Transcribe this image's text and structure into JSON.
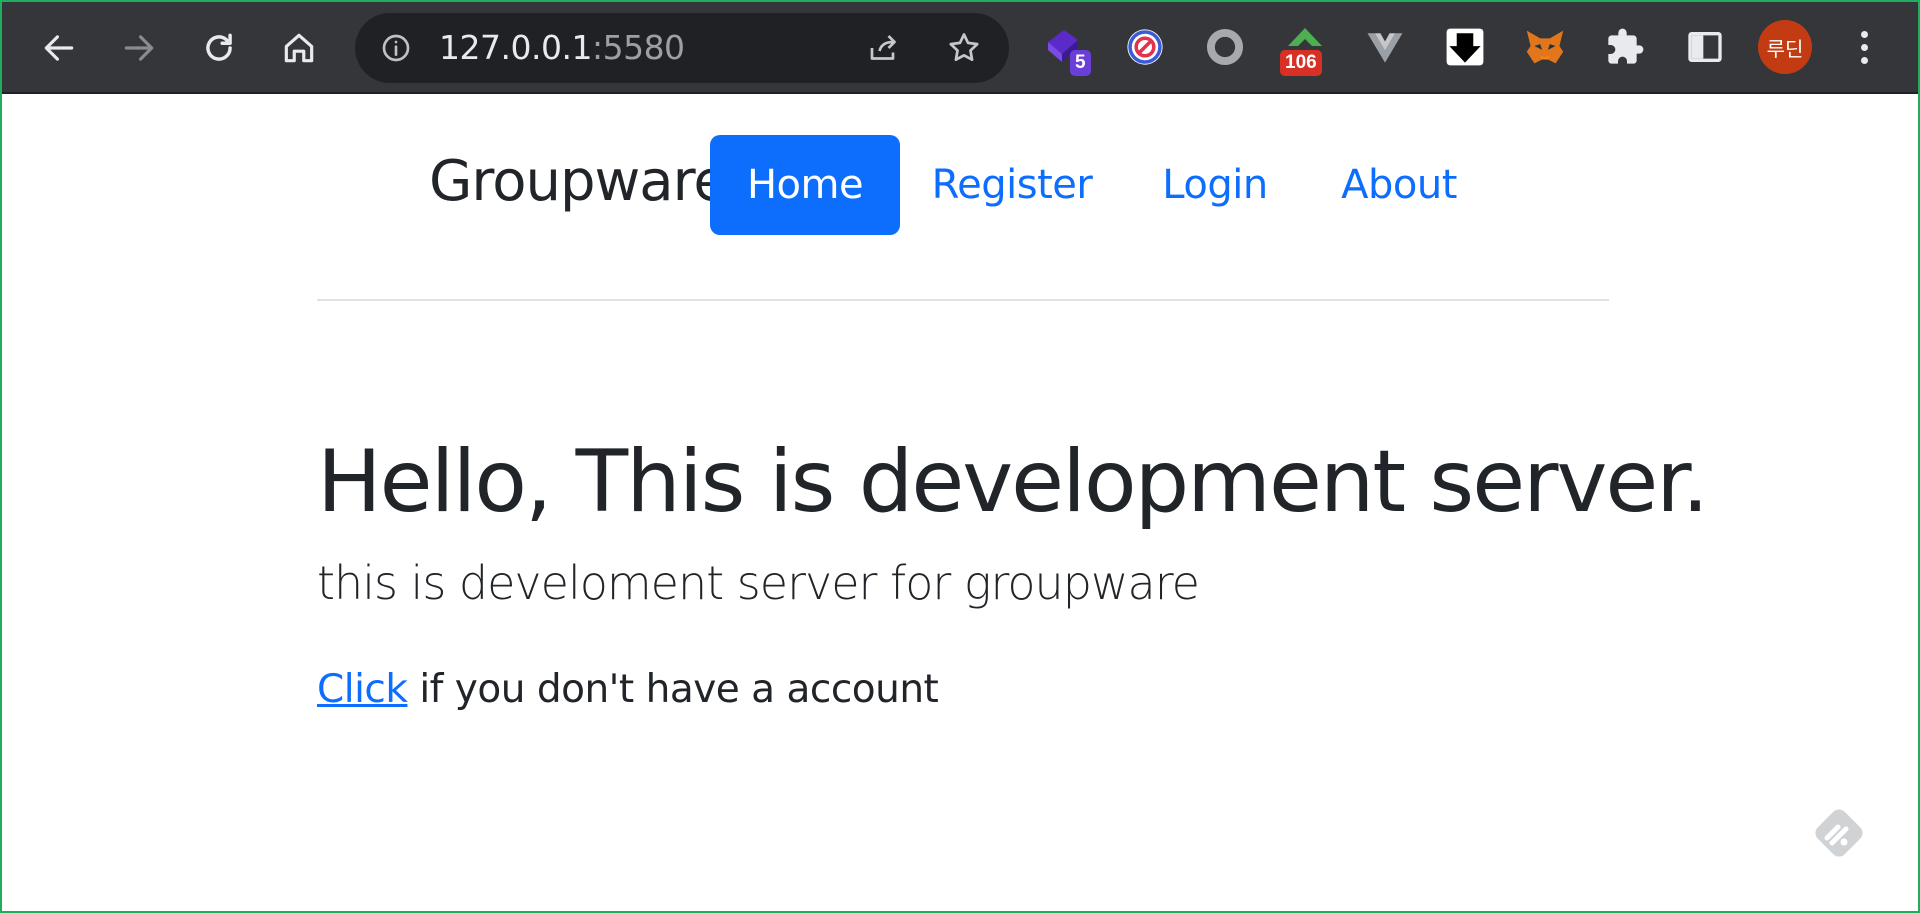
{
  "browser": {
    "url_host": "127.0.0.1",
    "url_port": ":5580",
    "icons": {
      "back": "back-arrow-icon",
      "forward": "forward-arrow-icon",
      "reload": "reload-icon",
      "home": "home-icon",
      "site_info": "info-icon",
      "share": "share-icon",
      "bookmark": "star-icon"
    },
    "extensions": [
      {
        "name": "extension-purple-icon",
        "badge": "5",
        "badge_color": "#6a3fd8"
      },
      {
        "name": "extension-block-icon",
        "badge": "",
        "badge_color": ""
      },
      {
        "name": "extension-ring-icon",
        "badge": "",
        "badge_color": ""
      },
      {
        "name": "extension-green-icon",
        "badge": "106",
        "badge_color": "#d93025"
      },
      {
        "name": "extension-vue-icon",
        "badge": "",
        "badge_color": ""
      },
      {
        "name": "extension-download-icon",
        "badge": "",
        "badge_color": ""
      },
      {
        "name": "extension-metamask-icon",
        "badge": "",
        "badge_color": ""
      },
      {
        "name": "extensions-puzzle-icon",
        "badge": "",
        "badge_color": ""
      },
      {
        "name": "side-panel-icon",
        "badge": "",
        "badge_color": ""
      }
    ],
    "profile_initials": "루딘",
    "profile_color": "#c23b13"
  },
  "nav": {
    "brand": "Groupware",
    "items": [
      {
        "label": "Home",
        "active": true
      },
      {
        "label": "Register",
        "active": false
      },
      {
        "label": "Login",
        "active": false
      },
      {
        "label": "About",
        "active": false
      }
    ],
    "accent_color": "#0d6efd"
  },
  "hero": {
    "title": "Hello, This is development server.",
    "lead": "this is develoment server for groupware",
    "link_text": "Click",
    "link_suffix": " if you don't have a account"
  }
}
